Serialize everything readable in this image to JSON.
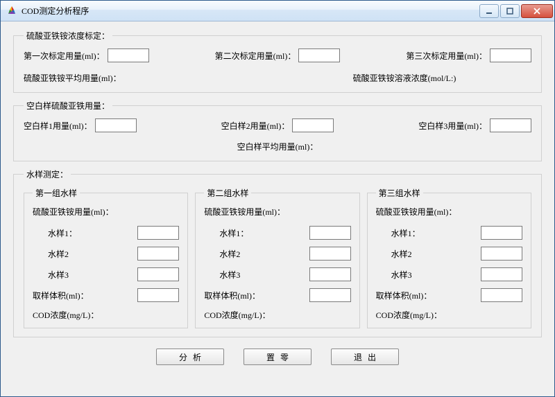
{
  "window": {
    "title": "COD测定分析程序"
  },
  "calibration": {
    "legend": "硫酸亚铁铵浓度标定：",
    "label1": "第一次标定用量(ml)：",
    "value1": "",
    "label2": "第二次标定用量(ml)：",
    "value2": "",
    "label3": "第三次标定用量(ml)：",
    "value3": "",
    "avg_label": "硫酸亚铁铵平均用量(ml)：",
    "conc_label": "硫酸亚铁铵溶液浓度(mol/L:)"
  },
  "blank": {
    "legend": "空白样硫酸亚铁用量：",
    "label1": "空白样1用量(ml)：",
    "value1": "",
    "label2": "空白样2用量(ml)：",
    "value2": "",
    "label3": "空白样3用量(ml)：",
    "value3": "",
    "avg_label": "空白样平均用量(ml)："
  },
  "samples": {
    "legend": "水样测定：",
    "groups": [
      {
        "legend": "第一组水样",
        "head": "硫酸亚铁铵用量(ml)：",
        "s1_label": "水样1：",
        "s1": "",
        "s2_label": "水样2",
        "s2": "",
        "s3_label": "水样3",
        "s3": "",
        "vol_label": "取样体积(ml)：",
        "vol": "",
        "cod_label": "COD浓度(mg/L)："
      },
      {
        "legend": "第二组水样",
        "head": "硫酸亚铁铵用量(ml)：",
        "s1_label": "水样1：",
        "s1": "",
        "s2_label": "水样2",
        "s2": "",
        "s3_label": "水样3",
        "s3": "",
        "vol_label": "取样体积(ml)：",
        "vol": "",
        "cod_label": "COD浓度(mg/L)："
      },
      {
        "legend": "第三组水样",
        "head": "硫酸亚铁铵用量(ml)：",
        "s1_label": "水样1：",
        "s1": "",
        "s2_label": "水样2",
        "s2": "",
        "s3_label": "水样3",
        "s3": "",
        "vol_label": "取样体积(ml)：",
        "vol": "",
        "cod_label": "COD浓度(mg/L)："
      }
    ]
  },
  "buttons": {
    "analyze": "分析",
    "reset": "置零",
    "exit": "退出"
  }
}
